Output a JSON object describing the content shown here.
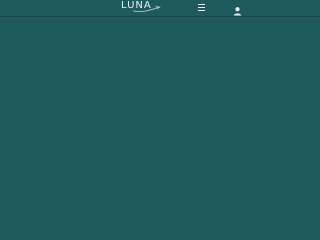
{
  "header": {
    "brand": "LUNA",
    "menu_icon": "hamburger-menu-icon",
    "user_icon": "user-icon"
  },
  "colors": {
    "background": "#1f5a5d",
    "header_background": "#1f5a5d",
    "foreground": "#e6f2f2"
  }
}
